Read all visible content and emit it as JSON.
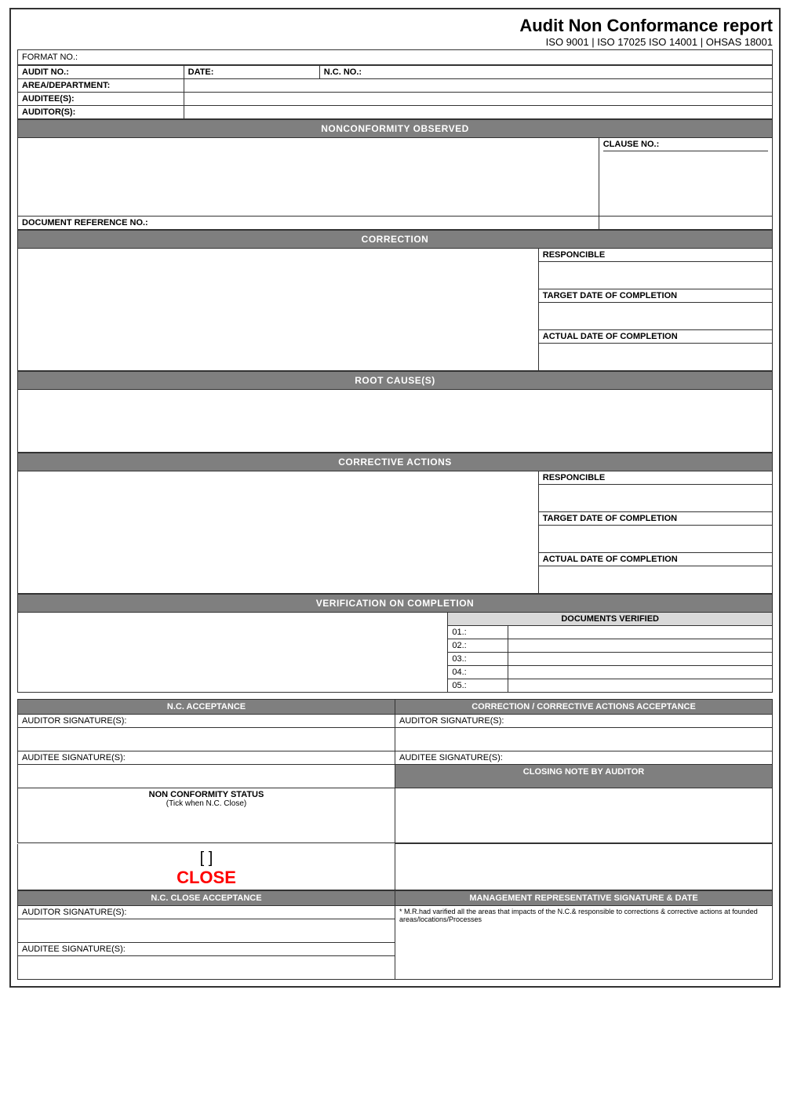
{
  "header": {
    "title": "Audit Non Conformance report",
    "subtitle": "ISO 9001 | ISO 17025 ISO 14001 | OHSAS 18001",
    "format_no_label": "FORMAT NO.:"
  },
  "fields": {
    "audit_no": "AUDIT NO.:",
    "date": "DATE:",
    "nc_no": "N.C. NO.:",
    "area_dept": "AREA/DEPARTMENT:",
    "auditee": "AUDITEE(S):",
    "auditor": "AUDITOR(S):"
  },
  "sections": {
    "nonconformity": "NONCONFORMITY OBSERVED",
    "clause_no": "CLAUSE NO.:",
    "doc_ref": "DOCUMENT REFERENCE NO.:",
    "correction": "CORRECTION",
    "responsible": "RESPONCIBLE",
    "target_date": "TARGET DATE OF COMPLETION",
    "actual_date": "ACTUAL DATE OF COMPLETION",
    "root_cause": "ROOT CAUSE(S)",
    "corrective_actions": "CORRECTIVE ACTIONS",
    "verification": "VERIFICATION ON COMPLETION",
    "documents_verified": "DOCUMENTS VERIFIED",
    "doc_items": [
      "01.:",
      "02.:",
      "03.:",
      "04.:",
      "05.:"
    ]
  },
  "bottom": {
    "nc_acceptance": "N.C. ACCEPTANCE",
    "correction_acceptance": "CORRECTION / CORRECTIVE ACTIONS ACCEPTANCE",
    "auditor_sig": "AUDITOR SIGNATURE(S):",
    "auditee_sig": "AUDITEE SIGNATURE(S):",
    "nc_status_label": "NON CONFORMITY STATUS",
    "nc_status_sub": "(Tick when N.C. Close)",
    "close_bracket": "[          ]",
    "close_text": "CLOSE",
    "closing_note": "CLOSING NOTE BY AUDITOR",
    "nc_close_acceptance": "N.C. CLOSE ACCEPTANCE",
    "mgmt_rep": "MANAGEMENT REPRESENTATIVE SIGNATURE & DATE",
    "footnote": "* M.R.had varified all the areas that impacts of the N.C.& responsible to corrections & corrective actions at founded areas/locations/Processes"
  }
}
